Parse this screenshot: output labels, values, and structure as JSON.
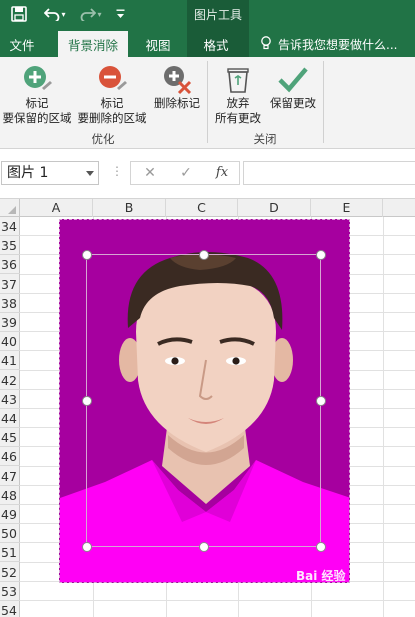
{
  "qat": {
    "save_icon": "floppy-save-icon",
    "undo_icon": "undo-icon",
    "redo_icon": "redo-icon",
    "customize_icon": "customize-qat-icon"
  },
  "context_tab_group": "图片工具",
  "tabs": [
    {
      "label": "文件",
      "active": false
    },
    {
      "label": "背景消除",
      "active": true
    },
    {
      "label": "视图",
      "active": false
    },
    {
      "label": "格式",
      "active": false
    }
  ],
  "tell_me": {
    "icon": "lightbulb-icon",
    "placeholder": "告诉我您想要做什么..."
  },
  "ribbon": {
    "groups": [
      {
        "label": "优化",
        "buttons": [
          {
            "line1": "标记",
            "line2": "要保留的区域",
            "icon": "mark-keep-icon"
          },
          {
            "line1": "标记",
            "line2": "要删除的区域",
            "icon": "mark-remove-icon"
          },
          {
            "line1": "删除标记",
            "line2": "",
            "icon": "delete-mark-icon"
          }
        ]
      },
      {
        "label": "关闭",
        "buttons": [
          {
            "line1": "放弃",
            "line2": "所有更改",
            "icon": "discard-icon"
          },
          {
            "line1": "保留更改",
            "line2": "",
            "icon": "keep-changes-icon"
          }
        ]
      }
    ]
  },
  "formula_bar": {
    "name_box": "图片 1",
    "cancel_symbol": "✕",
    "enter_symbol": "✓",
    "fx_label": "fx",
    "value": ""
  },
  "grid": {
    "columns": [
      "A",
      "B",
      "C",
      "D",
      "E"
    ],
    "rows": [
      "34",
      "35",
      "36",
      "37",
      "38",
      "39",
      "40",
      "41",
      "42",
      "43",
      "44",
      "45",
      "46",
      "47",
      "48",
      "49",
      "50",
      "51",
      "52",
      "53",
      "54"
    ]
  },
  "picture": {
    "description_icon": "portrait-photo",
    "background_color": "#a6009f",
    "shirt_color": "#ff00f5"
  },
  "watermark": "Bai 经验",
  "colors": {
    "excel_green": "#217346",
    "context_green": "#1a5c38",
    "ribbon_bg": "#f3f3f3",
    "keep_green": "#4fa37a",
    "remove_red": "#d9533a"
  }
}
